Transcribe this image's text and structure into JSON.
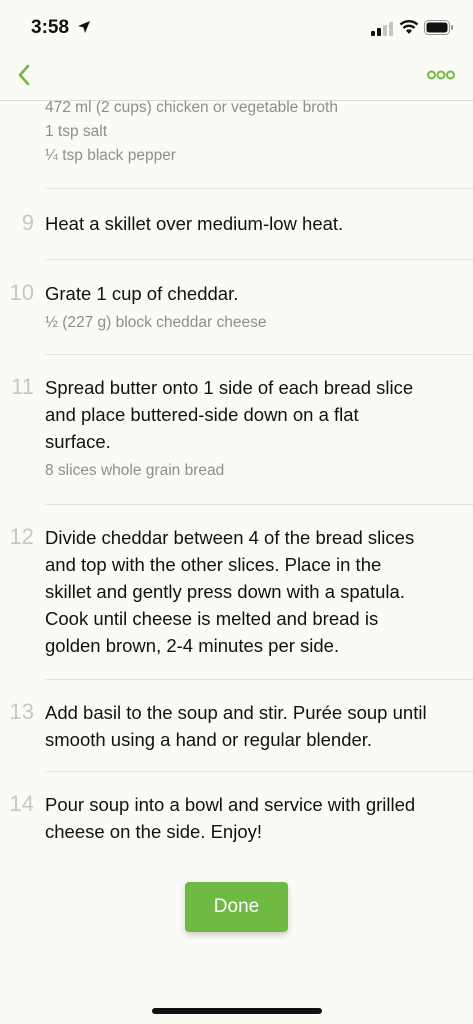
{
  "status_bar": {
    "time": "3:58"
  },
  "nav": {
    "accent_color": "#6fba43",
    "back_icon": "chevron-left-icon",
    "more_icon": "more-dots-icon"
  },
  "top_ingredients": [
    "472 ml (2 cups) chicken or vegetable broth",
    "1 tsp salt",
    "¼ tsp black pepper"
  ],
  "steps": [
    {
      "number": "9",
      "lines": [
        "Heat a skillet over medium-low heat."
      ],
      "ingredients": []
    },
    {
      "number": "10",
      "lines": [
        "Grate 1 cup of cheddar."
      ],
      "ingredients": [
        "½ (227 g) block cheddar cheese"
      ]
    },
    {
      "number": "11",
      "lines": [
        "Spread butter onto 1 side of each bread slice",
        "and place buttered-side down on a flat",
        "surface."
      ],
      "ingredients": [
        "8 slices whole grain bread"
      ]
    },
    {
      "number": "12",
      "lines": [
        "Divide cheddar between 4 of the bread slices",
        "and top with the other slices. Place in the",
        "skillet and gently press down with a spatula.",
        "Cook until cheese is melted and bread is",
        "golden brown, 2-4 minutes per side."
      ],
      "ingredients": []
    },
    {
      "number": "13",
      "lines": [
        "Add basil to the soup and stir. Purée soup until",
        "smooth using a hand or regular blender."
      ],
      "ingredients": []
    },
    {
      "number": "14",
      "lines": [
        "Pour soup into a bowl and service with grilled",
        "cheese on the side. Enjoy!"
      ],
      "ingredients": []
    }
  ],
  "done_button": {
    "label": "Done"
  }
}
